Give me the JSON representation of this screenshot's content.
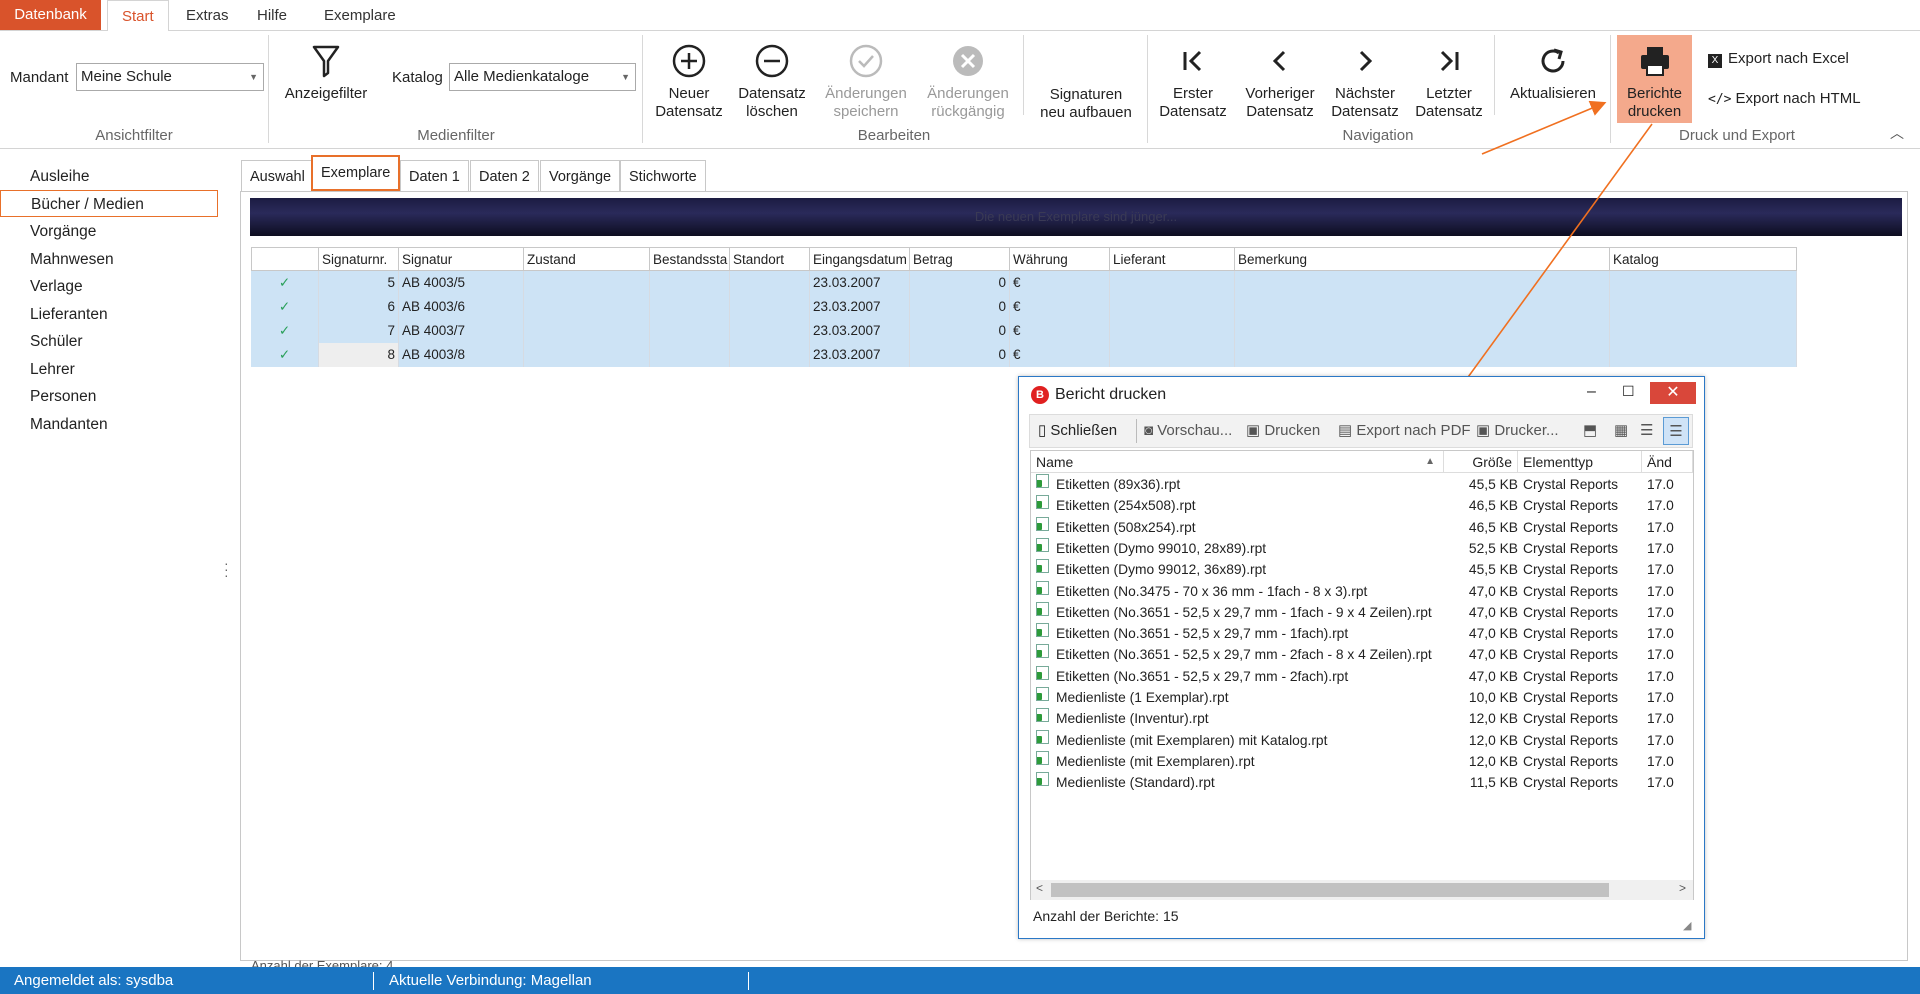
{
  "menu_tabs": [
    "Datenbank",
    "Start",
    "Extras",
    "Hilfe",
    "Exemplare"
  ],
  "ribbon": {
    "ansichtfilter": {
      "mandant_label": "Mandant",
      "mandant_value": "Meine Schule",
      "label": "Ansichtfilter"
    },
    "anzeigefilter": "Anzeigefilter",
    "medienfilter": {
      "katalog_label": "Katalog",
      "katalog_value": "Alle Medienkataloge",
      "label": "Medienfilter"
    },
    "bearbeiten": {
      "neu": [
        "Neuer",
        "Datensatz"
      ],
      "loeschen": [
        "Datensatz",
        "löschen"
      ],
      "speichern": [
        "Änderungen",
        "speichern"
      ],
      "rueckgaengig": [
        "Änderungen",
        "rückgängig"
      ],
      "signaturen": [
        "Signaturen",
        "neu aufbauen"
      ],
      "label": "Bearbeiten"
    },
    "navigation": {
      "erster": [
        "Erster",
        "Datensatz"
      ],
      "vorheriger": [
        "Vorheriger",
        "Datensatz"
      ],
      "naechster": [
        "Nächster",
        "Datensatz"
      ],
      "letzter": [
        "Letzter",
        "Datensatz"
      ],
      "aktualisieren": "Aktualisieren",
      "label": "Navigation"
    },
    "druck": {
      "berichte": [
        "Berichte",
        "drucken"
      ],
      "excel": "Export nach Excel",
      "html": "Export nach HTML",
      "label": "Druck und Export"
    }
  },
  "sidebar": [
    "Ausleihe",
    "Bücher / Medien",
    "Vorgänge",
    "Mahnwesen",
    "Verlage",
    "Lieferanten",
    "Schüler",
    "Lehrer",
    "Personen",
    "Mandanten"
  ],
  "content_tabs": [
    "Auswahl",
    "Exemplare",
    "Daten 1",
    "Daten 2",
    "Vorgänge",
    "Stichworte"
  ],
  "banner_text": "Die neuen Exemplare sind jünger...",
  "grid": {
    "columns": [
      "",
      "Signaturnr.",
      "Signatur",
      "Zustand",
      "Bestandssta",
      "Standort",
      "Eingangsdatum",
      "Betrag",
      "Währung",
      "Lieferant",
      "Bemerkung",
      "Katalog"
    ],
    "rows": [
      {
        "nr": "5",
        "sig": "AB 4003/5",
        "datum": "23.03.2007",
        "betrag": "0",
        "waehrung": "€"
      },
      {
        "nr": "6",
        "sig": "AB 4003/6",
        "datum": "23.03.2007",
        "betrag": "0",
        "waehrung": "€"
      },
      {
        "nr": "7",
        "sig": "AB 4003/7",
        "datum": "23.03.2007",
        "betrag": "0",
        "waehrung": "€"
      },
      {
        "nr": "8",
        "sig": "AB 4003/8",
        "datum": "23.03.2007",
        "betrag": "0",
        "waehrung": "€"
      }
    ],
    "footer": "Anzahl der Exemplare: 4"
  },
  "dialog": {
    "title": "Bericht drucken",
    "toolbar": {
      "close": "Schließen",
      "preview": "Vorschau...",
      "print": "Drucken",
      "pdf": "Export nach PDF",
      "printer": "Drucker..."
    },
    "columns": [
      "Name",
      "Größe",
      "Elementtyp",
      "Änd"
    ],
    "rows": [
      {
        "name": "Etiketten (89x36).rpt",
        "size": "45,5 KB",
        "type": "Crystal Reports",
        "date": "17.0"
      },
      {
        "name": "Etiketten (254x508).rpt",
        "size": "46,5 KB",
        "type": "Crystal Reports",
        "date": "17.0"
      },
      {
        "name": "Etiketten (508x254).rpt",
        "size": "46,5 KB",
        "type": "Crystal Reports",
        "date": "17.0"
      },
      {
        "name": "Etiketten (Dymo 99010, 28x89).rpt",
        "size": "52,5 KB",
        "type": "Crystal Reports",
        "date": "17.0"
      },
      {
        "name": "Etiketten (Dymo 99012, 36x89).rpt",
        "size": "45,5 KB",
        "type": "Crystal Reports",
        "date": "17.0"
      },
      {
        "name": "Etiketten (No.3475 - 70 x 36 mm - 1fach - 8 x 3).rpt",
        "size": "47,0 KB",
        "type": "Crystal Reports",
        "date": "17.0"
      },
      {
        "name": "Etiketten (No.3651 - 52,5 x 29,7 mm - 1fach - 9 x 4 Zeilen).rpt",
        "size": "47,0 KB",
        "type": "Crystal Reports",
        "date": "17.0"
      },
      {
        "name": "Etiketten (No.3651 - 52,5 x 29,7 mm - 1fach).rpt",
        "size": "47,0 KB",
        "type": "Crystal Reports",
        "date": "17.0"
      },
      {
        "name": "Etiketten (No.3651 - 52,5 x 29,7 mm - 2fach - 8 x 4 Zeilen).rpt",
        "size": "47,0 KB",
        "type": "Crystal Reports",
        "date": "17.0"
      },
      {
        "name": "Etiketten (No.3651 - 52,5 x 29,7 mm - 2fach).rpt",
        "size": "47,0 KB",
        "type": "Crystal Reports",
        "date": "17.0"
      },
      {
        "name": "Medienliste (1 Exemplar).rpt",
        "size": "10,0 KB",
        "type": "Crystal Reports",
        "date": "17.0"
      },
      {
        "name": "Medienliste (Inventur).rpt",
        "size": "12,0 KB",
        "type": "Crystal Reports",
        "date": "17.0"
      },
      {
        "name": "Medienliste (mit Exemplaren) mit Katalog.rpt",
        "size": "12,0 KB",
        "type": "Crystal Reports",
        "date": "17.0"
      },
      {
        "name": "Medienliste (mit Exemplaren).rpt",
        "size": "12,0 KB",
        "type": "Crystal Reports",
        "date": "17.0"
      },
      {
        "name": "Medienliste (Standard).rpt",
        "size": "11,5 KB",
        "type": "Crystal Reports",
        "date": "17.0"
      }
    ],
    "footer": "Anzahl der Berichte: 15"
  },
  "statusbar": {
    "user": "Angemeldet als: sysdba",
    "connection": "Aktuelle Verbindung: Magellan"
  },
  "colors": {
    "accent": "#d9532b",
    "highlight_border": "#e8702a",
    "arrow": "#f07020",
    "status": "#1a75c2",
    "selected_row": "#cde3f5"
  }
}
